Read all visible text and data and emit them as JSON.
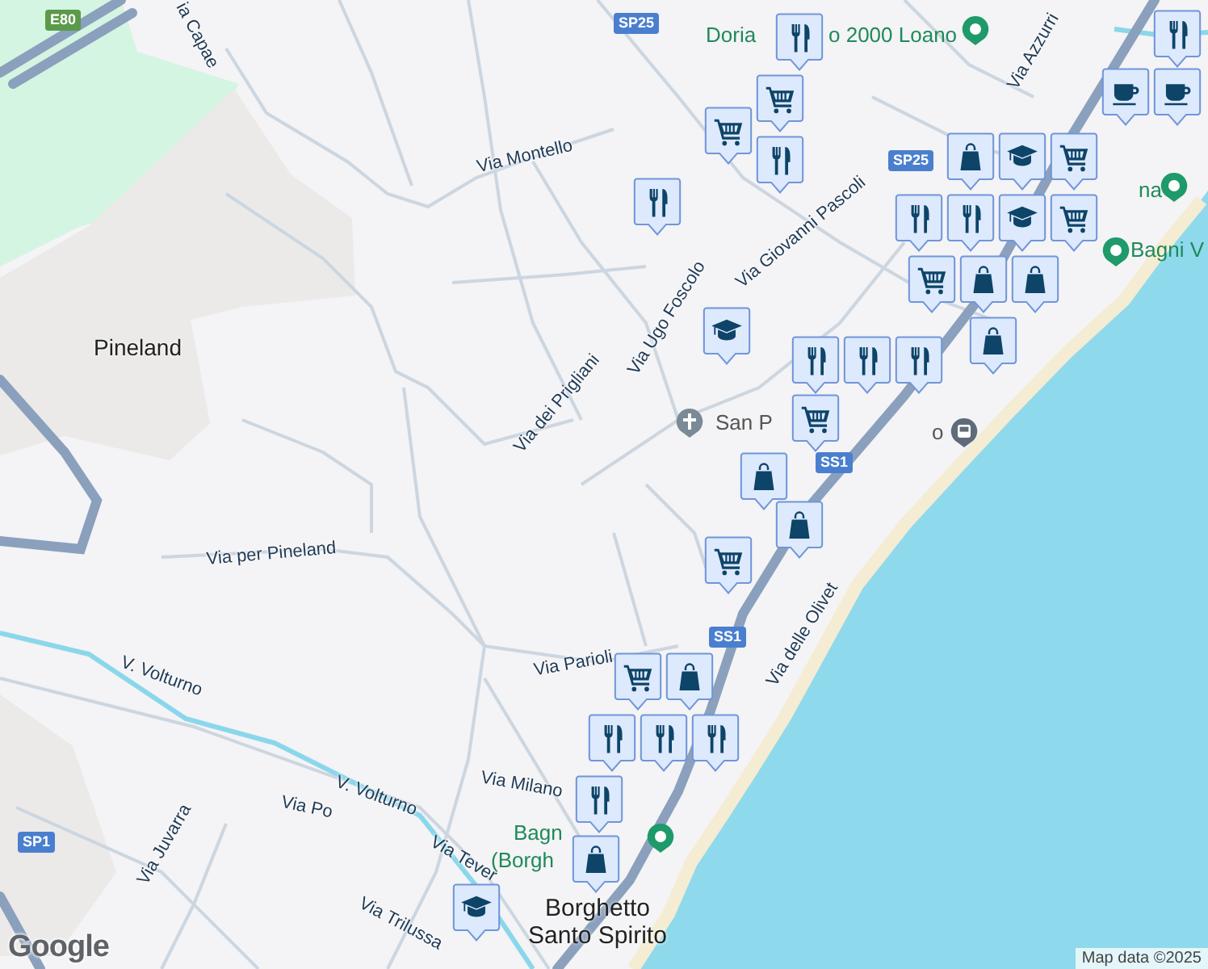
{
  "map": {
    "road_labels": [
      {
        "text": "ia Capae"
      },
      {
        "text": "Via Montello"
      },
      {
        "text": "Via dei Prigliani"
      },
      {
        "text": "Via Ugo Foscolo"
      },
      {
        "text": "Via Giovanni Pascoli"
      },
      {
        "text": "Via per Pineland"
      },
      {
        "text": "V. Volturno"
      },
      {
        "text": "V. Volturno"
      },
      {
        "text": "Via Po"
      },
      {
        "text": "Via Juvarra"
      },
      {
        "text": "Via Parioli"
      },
      {
        "text": "Via Milano"
      },
      {
        "text": "Via Tever"
      },
      {
        "text": "Via Trilussa"
      },
      {
        "text": "Via delle Olivet"
      },
      {
        "text": "Via Azzurri"
      }
    ],
    "road_shields": [
      {
        "text": "E80",
        "kind": "motorway"
      },
      {
        "text": "SP25",
        "kind": "road"
      },
      {
        "text": "SP25",
        "kind": "road"
      },
      {
        "text": "SS1",
        "kind": "road"
      },
      {
        "text": "SS1",
        "kind": "road"
      },
      {
        "text": "SP1",
        "kind": "road"
      }
    ],
    "place_labels": [
      {
        "text": "Pineland"
      },
      {
        "text": "Borghetto Santo Spirito"
      }
    ],
    "poi_labels": [
      {
        "text": "Doria",
        "kind": "park"
      },
      {
        "text": "o 2000 Loano",
        "kind": "park"
      },
      {
        "text": "na",
        "kind": "park"
      },
      {
        "text": "Bagni V",
        "kind": "park"
      },
      {
        "text": "San P",
        "kind": "church"
      },
      {
        "text": "o",
        "kind": "station"
      },
      {
        "text": "Bagn",
        "kind": "park"
      },
      {
        "text": "(Borgh",
        "kind": "park"
      }
    ],
    "markers": [
      {
        "kind": "restaurant"
      },
      {
        "kind": "cart"
      },
      {
        "kind": "cart"
      },
      {
        "kind": "restaurant"
      },
      {
        "kind": "restaurant"
      },
      {
        "kind": "restaurant"
      },
      {
        "kind": "cup"
      },
      {
        "kind": "cup"
      },
      {
        "kind": "bag"
      },
      {
        "kind": "cap"
      },
      {
        "kind": "cart"
      },
      {
        "kind": "restaurant"
      },
      {
        "kind": "restaurant"
      },
      {
        "kind": "cap"
      },
      {
        "kind": "cart"
      },
      {
        "kind": "cart"
      },
      {
        "kind": "bag"
      },
      {
        "kind": "bag"
      },
      {
        "kind": "bag"
      },
      {
        "kind": "cap"
      },
      {
        "kind": "restaurant"
      },
      {
        "kind": "restaurant"
      },
      {
        "kind": "restaurant"
      },
      {
        "kind": "cart"
      },
      {
        "kind": "bag"
      },
      {
        "kind": "cart"
      },
      {
        "kind": "bag"
      },
      {
        "kind": "cart"
      },
      {
        "kind": "bag"
      },
      {
        "kind": "restaurant"
      },
      {
        "kind": "restaurant"
      },
      {
        "kind": "restaurant"
      },
      {
        "kind": "restaurant"
      },
      {
        "kind": "bag"
      },
      {
        "kind": "cap"
      }
    ],
    "logo": "Google",
    "attribution": "Map data ©2025"
  }
}
